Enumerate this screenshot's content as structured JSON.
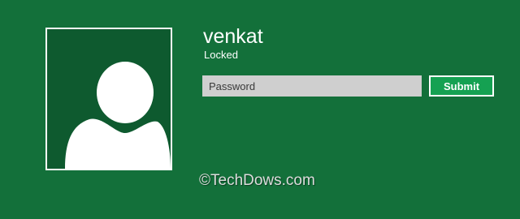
{
  "user": {
    "name": "venkat",
    "status": "Locked",
    "avatar_icon": "default-user-silhouette-icon"
  },
  "password_field": {
    "placeholder": "Password",
    "value": ""
  },
  "submit_button": {
    "label": "Submit"
  },
  "watermark": {
    "text": "©TechDows.com"
  },
  "colors": {
    "background": "#13703a",
    "avatar_tile": "#0e5a2f",
    "avatar_border": "#ffffff",
    "input_background": "#cfcfcf",
    "button_background": "#15a152"
  }
}
